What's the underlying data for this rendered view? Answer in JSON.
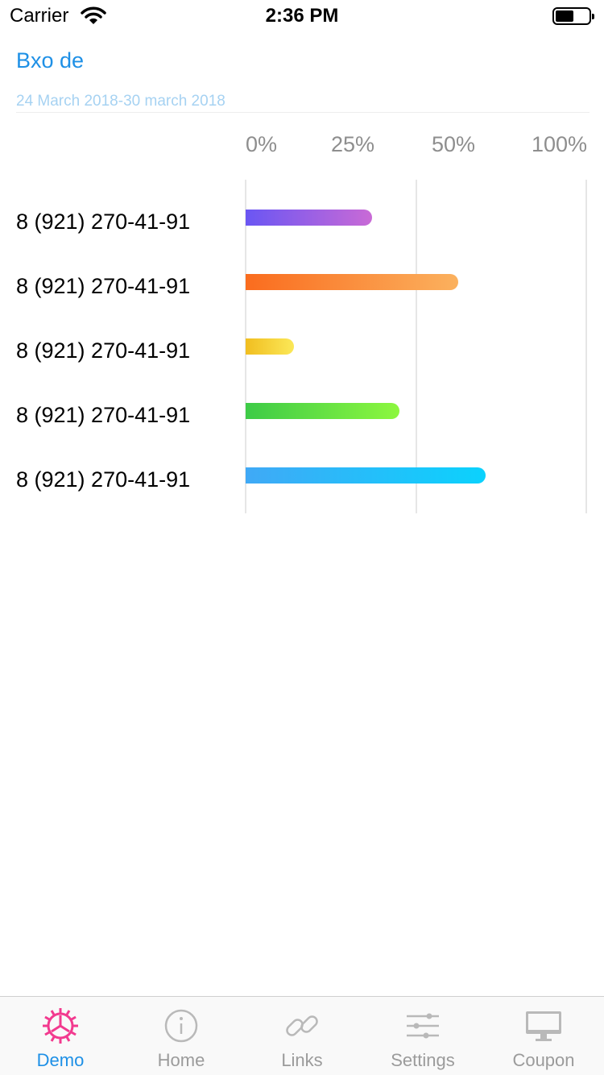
{
  "status_bar": {
    "carrier": "Carrier",
    "time": "2:36 PM",
    "battery_level": 0.55
  },
  "header": {
    "title": "Bxo de",
    "date_range": "24 March 2018-30 march 2018"
  },
  "chart_data": {
    "type": "bar",
    "orientation": "horizontal",
    "x_ticks": [
      "0%",
      "25%",
      "50%",
      "100%"
    ],
    "categories": [
      "8 (921) 270-41-91",
      "8 (921) 270-41-91",
      "8 (921) 270-41-91",
      "8 (921) 270-41-91",
      "8 (921) 270-41-91"
    ],
    "values": [
      37,
      62,
      14,
      45,
      70
    ],
    "xlim": [
      0,
      100
    ],
    "value_unit": "%",
    "colors": [
      [
        "#6A56F3",
        "#C96AD6"
      ],
      [
        "#FA6C1E",
        "#FBB15E"
      ],
      [
        "#F1BE20",
        "#FBE858"
      ],
      [
        "#3DCB47",
        "#8DF73F"
      ],
      [
        "#40A9F6",
        "#0BD2FD"
      ]
    ]
  },
  "tab_bar": {
    "active_index": 0,
    "items": [
      {
        "label": "Demo",
        "icon": "gear-icon"
      },
      {
        "label": "Home",
        "icon": "info-icon"
      },
      {
        "label": "Links",
        "icon": "link-icon"
      },
      {
        "label": "Settings",
        "icon": "sliders-icon"
      },
      {
        "label": "Coupon",
        "icon": "monitor-icon"
      }
    ],
    "active_color": "#1E90E6",
    "active_icon_color": "#F23A8F",
    "inactive_color": "#9B9B9B"
  }
}
